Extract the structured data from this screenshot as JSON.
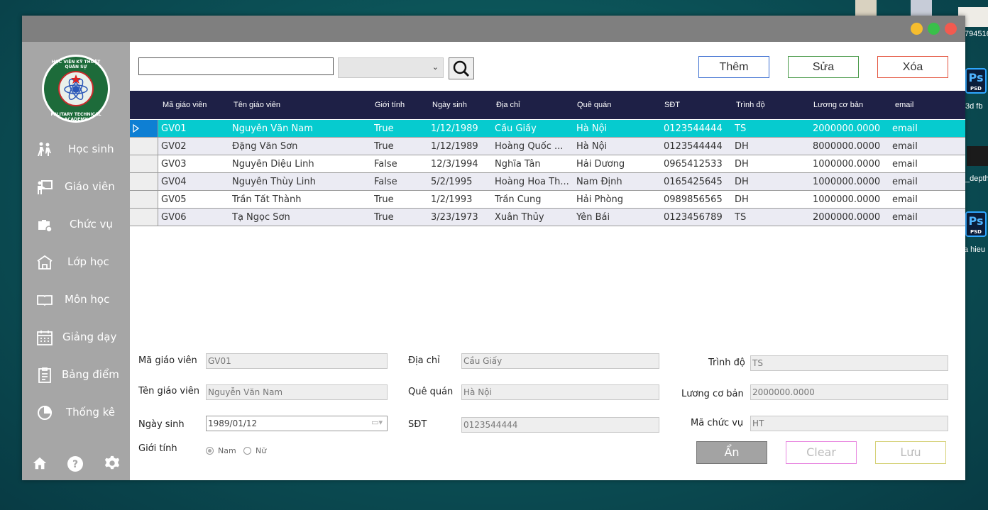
{
  "desktop": {
    "top_right_label": "794516",
    "icon1_label": "3d fb",
    "icon2_label": "_depth",
    "icon3_label": "a hieu",
    "ps_text": "Ps",
    "ps_sub": "PSD"
  },
  "logo": {
    "top_text": "HỌC VIỆN KỸ THUẬT QUÂN SỰ",
    "bottom_text": "MILITARY TECHNICAL ACADEMY"
  },
  "sidebar": {
    "items": [
      {
        "label": "Học sinh",
        "icon": "students-icon"
      },
      {
        "label": "Giáo viên",
        "icon": "teacher-icon"
      },
      {
        "label": "Chức vụ",
        "icon": "briefcase-icon"
      },
      {
        "label": "Lớp học",
        "icon": "school-icon"
      },
      {
        "label": "Môn học",
        "icon": "book-icon"
      },
      {
        "label": "Giảng dạy",
        "icon": "calendar-icon"
      },
      {
        "label": "Bảng điểm",
        "icon": "clipboard-icon"
      },
      {
        "label": "Thống kê",
        "icon": "pie-chart-icon"
      }
    ]
  },
  "toolbar": {
    "search_value": "",
    "combo_value": "",
    "add_label": "Thêm",
    "edit_label": "Sửa",
    "delete_label": "Xóa"
  },
  "grid": {
    "columns": [
      "Mã giáo viên",
      "Tên giáo viên",
      "Giới tính",
      "Ngày sinh",
      "Địa chỉ",
      "Quê quán",
      "SĐT",
      "Trình độ",
      "Lương cơ bản",
      "email"
    ],
    "rows": [
      [
        "GV01",
        "Nguyễn Văn Nam",
        "True",
        "1/12/1989",
        "Cầu Giấy",
        "Hà Nội",
        "0123544444",
        "TS",
        "2000000.0000",
        "email"
      ],
      [
        "GV02",
        "Đặng Văn Sơn",
        "True",
        "1/12/1989",
        "Hoàng Quốc ...",
        "Hà Nội",
        "0123544444",
        "DH",
        "8000000.0000",
        "email"
      ],
      [
        "GV03",
        "Nguyễn Diệu Linh",
        "False",
        "12/3/1994",
        "Nghĩa Tân",
        "Hải Dương",
        "0965412533",
        "DH",
        "1000000.0000",
        "email"
      ],
      [
        "GV04",
        "Nguyễn Thùy Linh",
        "False",
        "5/2/1995",
        "Hoàng Hoa Th...",
        "Nam Định",
        "0165425645",
        "DH",
        "1000000.0000",
        "email"
      ],
      [
        "GV05",
        "Trần Tất Thành",
        "True",
        "1/2/1993",
        "Trần Cung",
        "Hải Phòng",
        "0989856565",
        "DH",
        "1000000.0000",
        "email"
      ],
      [
        "GV06",
        "Tạ Ngọc Sơn",
        "True",
        "3/23/1973",
        "Xuân Thủy",
        "Yên Bái",
        "0123456789",
        "TS",
        "2000000.0000",
        "email"
      ]
    ]
  },
  "form": {
    "ma_gv_label": "Mã giáo viên",
    "ma_gv_value": "GV01",
    "ten_gv_label": "Tên giáo viên",
    "ten_gv_value": "Nguyễn Văn Nam",
    "ngay_sinh_label": "Ngày sinh",
    "ngay_sinh_value": "1989/01/12",
    "gioi_tinh_label": "Giới tính",
    "nam_label": "Nam",
    "nu_label": "Nữ",
    "dia_chi_label": "Địa chỉ",
    "dia_chi_value": "Cầu Giấy",
    "que_quan_label": "Quê quán",
    "que_quan_value": "Hà Nội",
    "sdt_label": "SĐT",
    "sdt_value": "0123544444",
    "trinh_do_label": "Trình độ",
    "trinh_do_value": "TS",
    "luong_label": "Lương cơ bản",
    "luong_value": "2000000.0000",
    "ma_cv_label": "Mã chức vụ",
    "ma_cv_value": "HT",
    "hide_label": "Ẩn",
    "clear_label": "Clear",
    "save_label": "Lưu"
  }
}
